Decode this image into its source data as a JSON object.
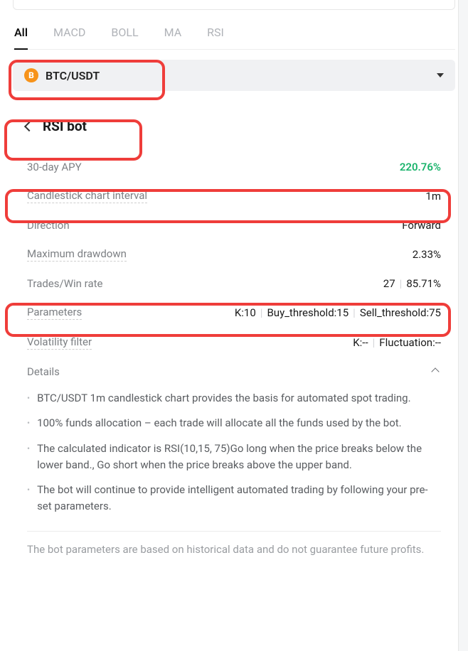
{
  "tabs": [
    "All",
    "MACD",
    "BOLL",
    "MA",
    "RSI"
  ],
  "dropdown": {
    "pair": "BTC/USDT",
    "icon_letter": "B"
  },
  "section": {
    "title": "RSI bot"
  },
  "stats": {
    "apy_label": "30-day APY",
    "apy_value": "220.76%",
    "interval_label": "Candlestick chart interval",
    "interval_value": "1m",
    "direction_label": "Direction",
    "direction_value": "Forward",
    "drawdown_label": "Maximum drawdown",
    "drawdown_value": "2.33%",
    "trades_label": "Trades/Win rate",
    "trades_count": "27",
    "win_rate": "85.71%",
    "params_label": "Parameters",
    "params_k": "K:10",
    "params_buy": "Buy_threshold:15",
    "params_sell": "Sell_threshold:75",
    "vol_label": "Volatility filter",
    "vol_k": "K:--",
    "vol_fluct": "Fluctuation:--",
    "details_label": "Details"
  },
  "bullets": [
    "BTC/USDT 1m candlestick chart provides the basis for automated spot trading.",
    "100% funds allocation – each trade will allocate all the funds used by the bot.",
    "The calculated indicator is RSI(10,15, 75)Go long when the price breaks below the lower band., Go short when the price breaks above the upper band.",
    "The bot will continue to provide intelligent automated trading by following your pre-set parameters."
  ],
  "disclaimer": "The bot parameters are based on historical data and do not guarantee future profits."
}
